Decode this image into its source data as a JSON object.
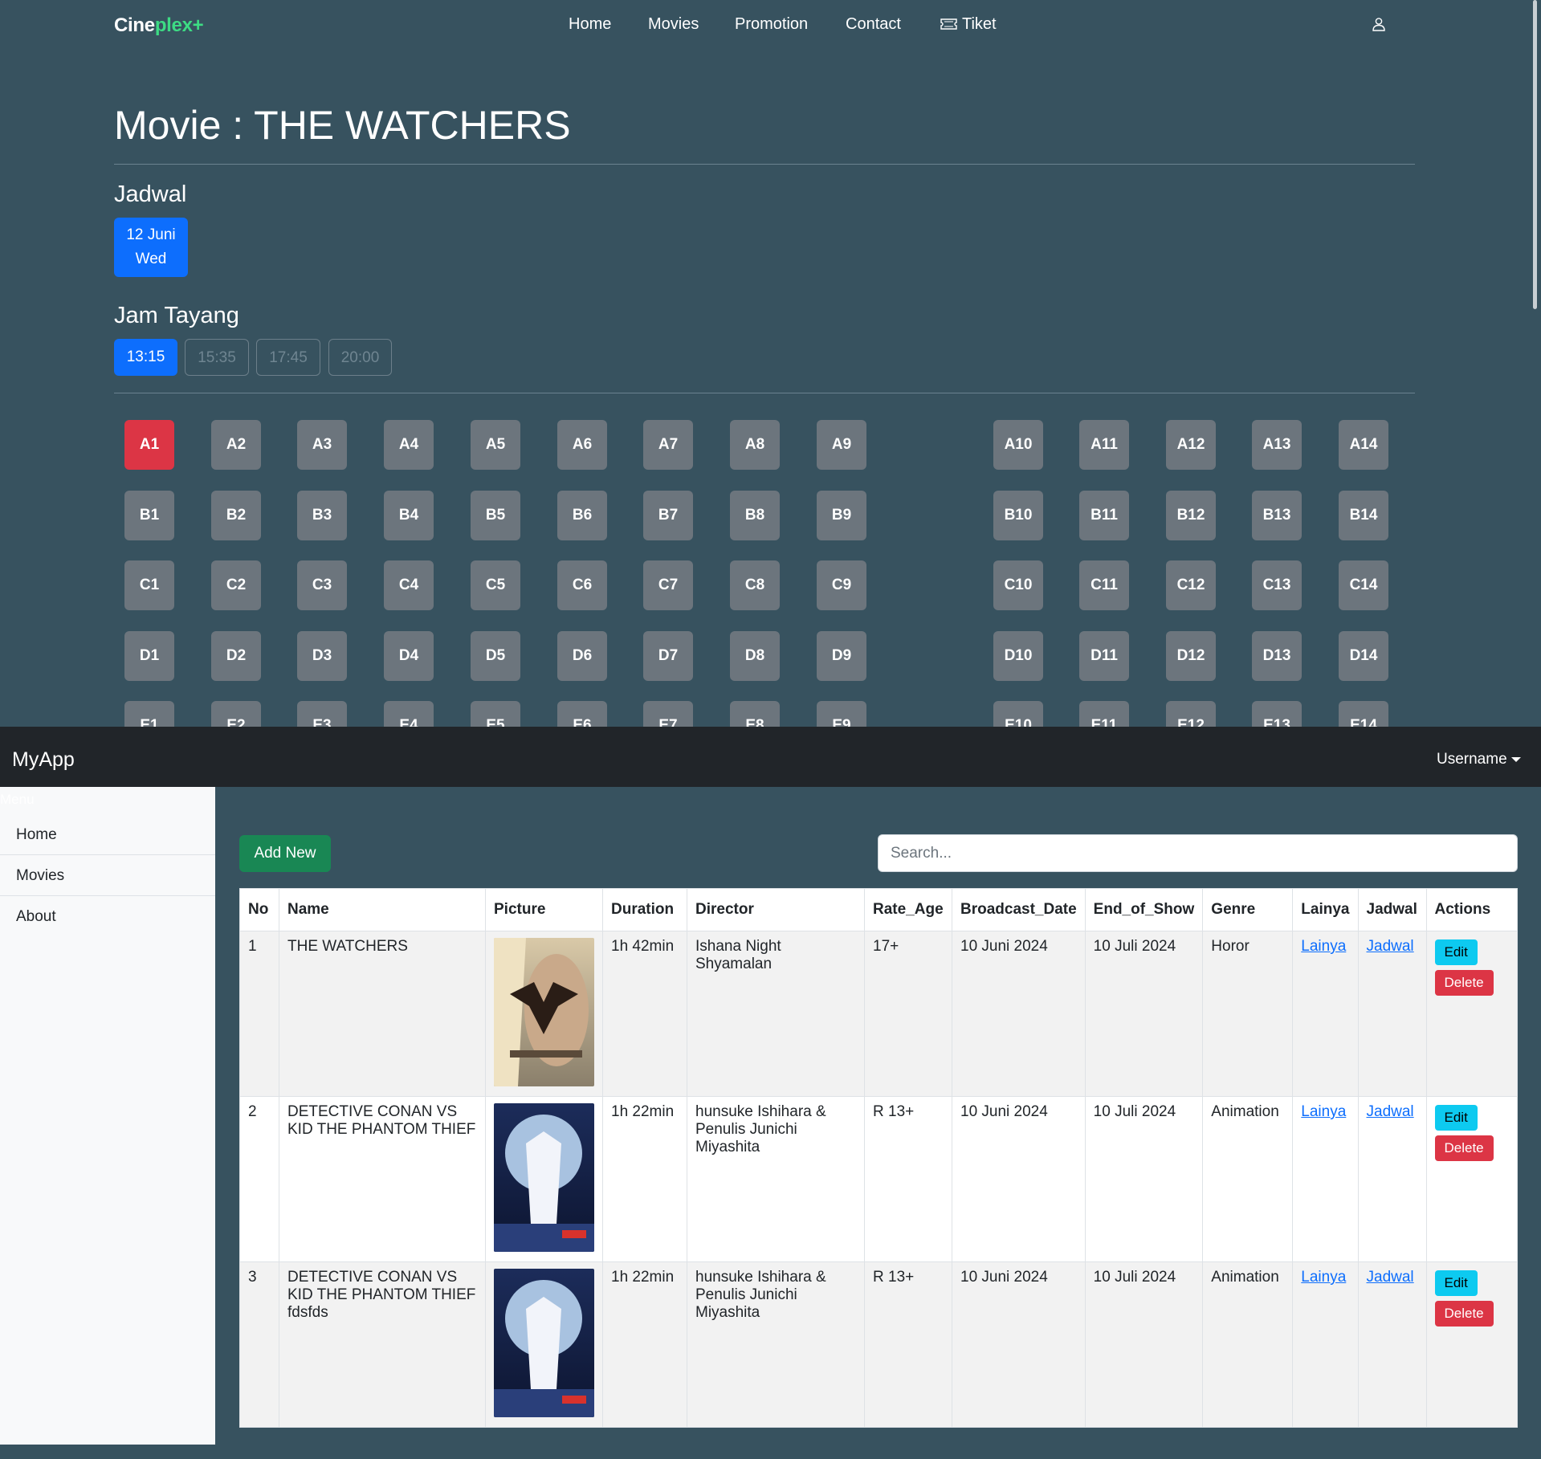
{
  "site": {
    "brand_part1": "Cine",
    "brand_part2": "plex+",
    "nav": [
      "Home",
      "Movies",
      "Promotion",
      "Contact",
      "Tiket"
    ],
    "user_icon": "user-icon",
    "ticket_icon": "ticket-icon"
  },
  "movie_page": {
    "title": "Movie : THE WATCHERS",
    "schedule_heading": "Jadwal",
    "date": {
      "day": "12 Juni",
      "weekday": "Wed"
    },
    "showtime_heading": "Jam Tayang",
    "showtimes": [
      {
        "time": "13:15",
        "state": "active"
      },
      {
        "time": "15:35",
        "state": "disabled"
      },
      {
        "time": "17:45",
        "state": "disabled"
      },
      {
        "time": "20:00",
        "state": "disabled"
      }
    ],
    "seat_rows": [
      "A",
      "B",
      "C",
      "D",
      "E"
    ],
    "seats_per_row": 14,
    "selected_seat": "A1"
  },
  "admin": {
    "brand": "MyApp",
    "username": "Username",
    "sidebar_title": "Menu",
    "sidebar_items": [
      "Home",
      "Movies",
      "About"
    ],
    "add_button": "Add New",
    "search_placeholder": "Search...",
    "columns": [
      "No",
      "Name",
      "Picture",
      "Duration",
      "Director",
      "Rate_Age",
      "Broadcast_Date",
      "End_of_Show",
      "Genre",
      "Lainya",
      "Jadwal",
      "Actions"
    ],
    "rows": [
      {
        "no": "1",
        "name": "THE WATCHERS",
        "poster": "watchers",
        "duration": "1h 42min",
        "director": "Ishana Night Shyamalan",
        "rate_age": "17+",
        "broadcast": "10 Juni 2024",
        "end": "10 Juli 2024",
        "genre": "Horor",
        "lainya": "Lainya",
        "jadwal": "Jadwal",
        "edit": "Edit",
        "delete": "Delete"
      },
      {
        "no": "2",
        "name": "DETECTIVE CONAN VS KID THE PHANTOM THIEF",
        "poster": "conan",
        "duration": "1h 22min",
        "director": "hunsuke Ishihara & Penulis Junichi Miyashita",
        "rate_age": "R 13+",
        "broadcast": "10 Juni 2024",
        "end": "10 Juli 2024",
        "genre": "Animation",
        "lainya": "Lainya",
        "jadwal": "Jadwal",
        "edit": "Edit",
        "delete": "Delete"
      },
      {
        "no": "3",
        "name": "DETECTIVE CONAN VS KID THE PHANTOM THIEF fdsfds",
        "poster": "conan",
        "duration": "1h 22min",
        "director": "hunsuke Ishihara & Penulis Junichi Miyashita",
        "rate_age": "R 13+",
        "broadcast": "10 Juni 2024",
        "end": "10 Juli 2024",
        "genre": "Animation",
        "lainya": "Lainya",
        "jadwal": "Jadwal",
        "edit": "Edit",
        "delete": "Delete"
      }
    ]
  },
  "colors": {
    "page_bg": "#37525f",
    "primary": "#0d6efd",
    "seat": "#6c757d",
    "seat_selected": "#dc3545",
    "brand_accent": "#3ddc84"
  }
}
